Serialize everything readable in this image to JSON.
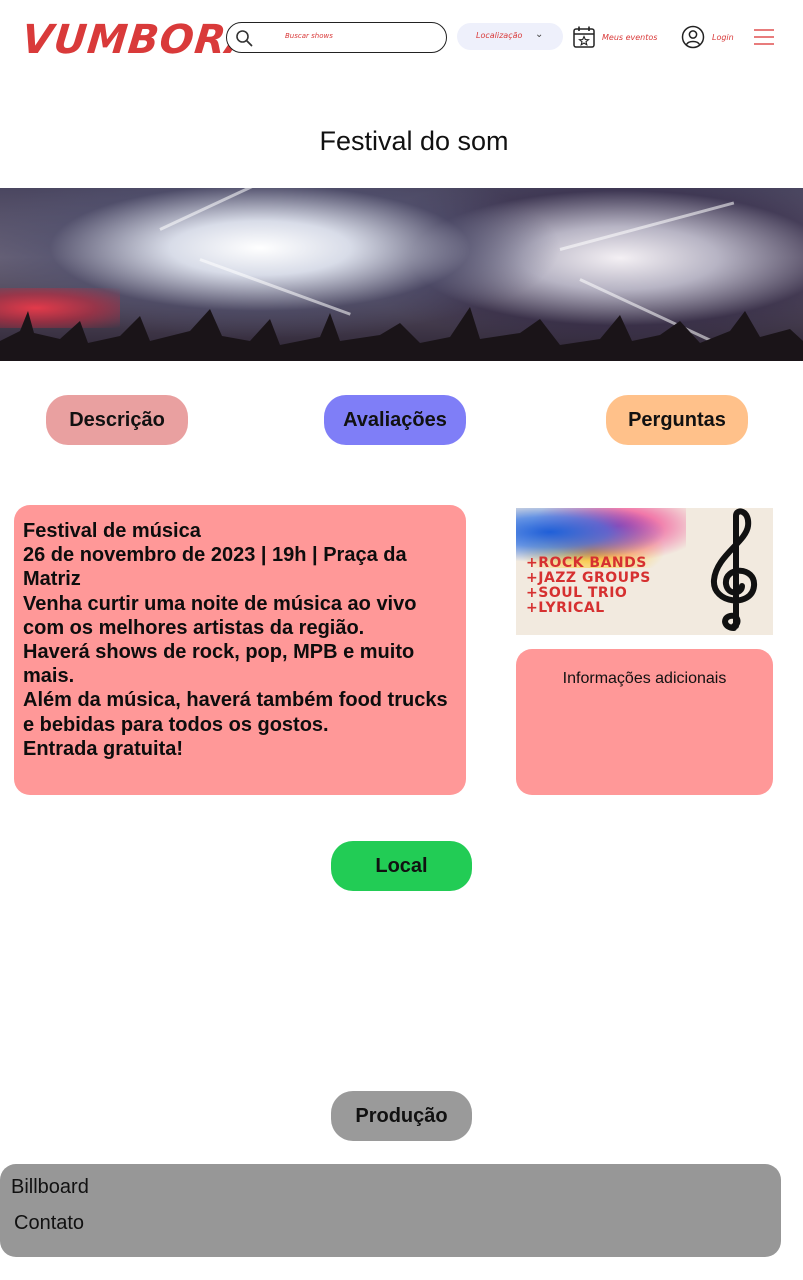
{
  "header": {
    "logo_text": "VUMBORA?",
    "search_placeholder": "Buscar shows",
    "location_label": "Localização",
    "my_events_label": "Meus eventos",
    "login_label": "Login"
  },
  "page": {
    "title": "Festival do som"
  },
  "tabs": [
    {
      "label": "Descrição",
      "color": "#e9a0a0"
    },
    {
      "label": "Avaliações",
      "color": "#7f7ef7"
    },
    {
      "label": "Perguntas",
      "color": "#ffc18a"
    }
  ],
  "description": {
    "lines": [
      "Festival de música",
      "26 de novembro de 2023 | 19h | Praça da Matriz",
      "Venha curtir uma noite de música ao vivo com os melhores artistas da região.",
      "Haverá shows de rock, pop, MPB e muito mais.",
      "Além da música, haverá também food trucks e bebidas para todos os gostos.",
      "Entrada gratuita!"
    ]
  },
  "poster": {
    "lines": [
      "+ROCK BANDS",
      "+JAZZ GROUPS",
      "+SOUL TRIO",
      "+LYRICAL"
    ]
  },
  "info_card": {
    "label": "Informações adicionais"
  },
  "buttons": {
    "local": "Local",
    "producao": "Produção"
  },
  "footer": {
    "links": [
      "Billboard",
      "Contato"
    ]
  },
  "colors": {
    "brand": "#d93a3a",
    "card": "#ff9898",
    "local_button": "#22cc55",
    "footer": "#979797"
  }
}
